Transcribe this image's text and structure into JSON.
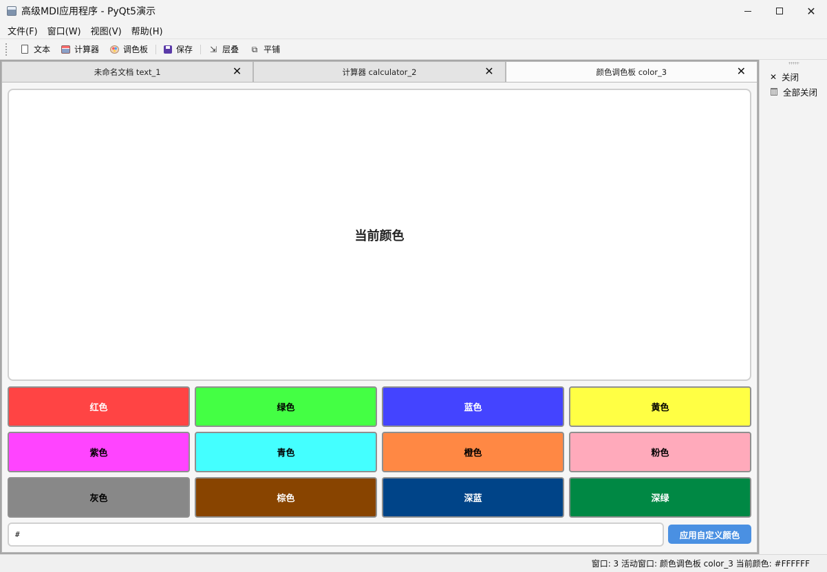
{
  "window": {
    "title": "高级MDI应用程序 - PyQt5演示",
    "controls": {
      "minimize": "minimize",
      "maximize": "maximize",
      "close": "✕"
    }
  },
  "menubar": {
    "items": [
      {
        "label": "文件(F)"
      },
      {
        "label": "窗口(W)"
      },
      {
        "label": "视图(V)"
      },
      {
        "label": "帮助(H)"
      }
    ]
  },
  "toolbar": {
    "items": [
      {
        "label": "文本",
        "icon": "document-icon"
      },
      {
        "label": "计算器",
        "icon": "calculator-icon"
      },
      {
        "label": "调色板",
        "icon": "palette-icon"
      },
      {
        "label": "保存",
        "icon": "save-icon"
      },
      {
        "label": "层叠",
        "icon": "cascade-icon"
      },
      {
        "label": "平铺",
        "icon": "tile-icon"
      }
    ]
  },
  "tabs": [
    {
      "label": "未命名文档 text_1",
      "active": false
    },
    {
      "label": "计算器 calculator_2",
      "active": false
    },
    {
      "label": "颜色调色板 color_3",
      "active": true
    }
  ],
  "palette": {
    "preview_label": "当前颜色",
    "preview_color": "#FFFFFF",
    "swatches": [
      {
        "label": "红色",
        "bg": "#ff4444",
        "fg": "#ffffff"
      },
      {
        "label": "绿色",
        "bg": "#44ff44",
        "fg": "#000000"
      },
      {
        "label": "蓝色",
        "bg": "#4444ff",
        "fg": "#ffffff"
      },
      {
        "label": "黄色",
        "bg": "#ffff44",
        "fg": "#000000"
      },
      {
        "label": "紫色",
        "bg": "#ff44ff",
        "fg": "#000000"
      },
      {
        "label": "青色",
        "bg": "#44ffff",
        "fg": "#000000"
      },
      {
        "label": "橙色",
        "bg": "#ff8844",
        "fg": "#000000"
      },
      {
        "label": "粉色",
        "bg": "#ffaabb",
        "fg": "#000000"
      },
      {
        "label": "灰色",
        "bg": "#888888",
        "fg": "#000000"
      },
      {
        "label": "棕色",
        "bg": "#884400",
        "fg": "#ffffff"
      },
      {
        "label": "深蓝",
        "bg": "#004488",
        "fg": "#ffffff"
      },
      {
        "label": "深绿",
        "bg": "#008844",
        "fg": "#ffffff"
      }
    ],
    "hex_input_value": "#",
    "apply_button": "应用自定义颜色"
  },
  "side_panel": {
    "close_label": "关闭",
    "close_all_label": "全部关闭"
  },
  "statusbar": {
    "text": "窗口: 3 活动窗口: 颜色调色板 color_3 当前颜色: #FFFFFF"
  }
}
